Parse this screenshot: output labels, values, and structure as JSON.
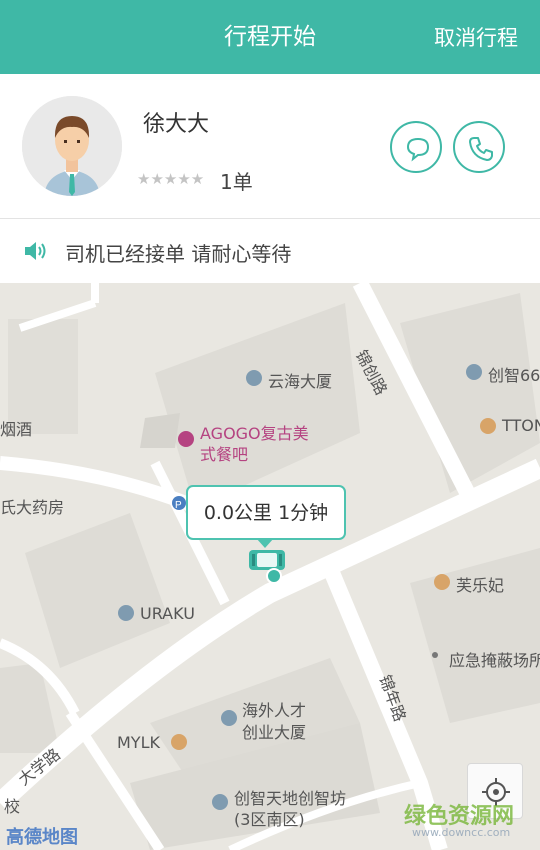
{
  "header": {
    "title": "行程开始",
    "cancel_label": "取消行程"
  },
  "driver": {
    "name": "徐大大",
    "stars": "★★★★★",
    "orders": "1单",
    "message_icon": "chat-bubble-icon",
    "call_icon": "phone-icon"
  },
  "notice": {
    "icon": "speaker-icon",
    "text": "司机已经接单 请耐心等待"
  },
  "map": {
    "bubble": "0.0公里 1分钟",
    "pois": {
      "yunhai": "云海大厦",
      "chuangzhi66": "创智66",
      "tton": "TTON",
      "agogo": "AGOGO复古美",
      "agogo2": "式餐吧",
      "yanjiu": "烟酒",
      "pharmacy": "氏大药房",
      "uraku": "URAKU",
      "fulefei": "芙乐妃",
      "shelter": "应急掩蔽场所",
      "haiwai1": "海外人才",
      "haiwai2": "创业大厦",
      "mylk": "MYLK",
      "chuangzhitiandi1": "创智天地创智坊",
      "chuangzhitiandi2": "(3区南区)",
      "school": "校"
    },
    "roads": {
      "jinchuang": "锦创路",
      "jinnian": "锦年路",
      "daxue": "大学路"
    },
    "logo": "高德地图",
    "watermark": "绿色资源网",
    "watermark_url": "www.downcc.com"
  },
  "colors": {
    "accent": "#3fb8a6",
    "poi_red": "#b54381"
  }
}
